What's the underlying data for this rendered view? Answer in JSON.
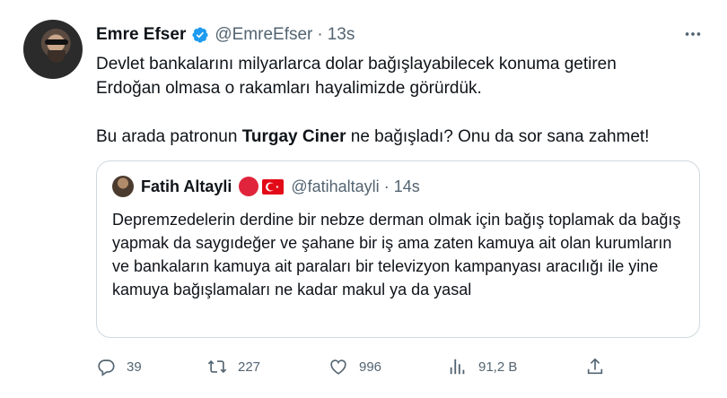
{
  "author": {
    "name": "Emre Efser",
    "handle": "@EmreEfser",
    "time": "13s"
  },
  "tweet": {
    "line1": "Devlet bankalarını milyarlarca dolar bağışlayabilecek konuma getiren",
    "line2": "Erdoğan olmasa o rakamları hayalimizde görürdük.",
    "line3_pre": "Bu arada patronun ",
    "line3_bold": "Turgay Ciner",
    "line3_post": " ne bağışladı? Onu da sor sana zahmet!"
  },
  "quote": {
    "name": "Fatih Altayli",
    "handle": "@fatihaltayli",
    "time": "14s",
    "text": "Depremzedelerin derdine bir nebze derman olmak için bağış toplamak da bağış yapmak da saygıdeğer ve şahane bir iş ama zaten kamuya ait olan kurumların ve bankaların kamuya ait paraları bir televizyon kampanyası aracılığı ile yine kamuya bağışlamaları ne kadar makul ya da yasal"
  },
  "actions": {
    "replies": "39",
    "retweets": "227",
    "likes": "996",
    "views": "91,2 B"
  },
  "icons": [
    "verified-badge-icon",
    "more-icon",
    "reply-icon",
    "retweet-icon",
    "like-icon",
    "views-icon",
    "share-icon",
    "red-circle-icon",
    "turkey-flag-icon"
  ],
  "colors": {
    "verified": "#1d9bf0",
    "secondary": "#536471",
    "border": "#cfd9de"
  }
}
